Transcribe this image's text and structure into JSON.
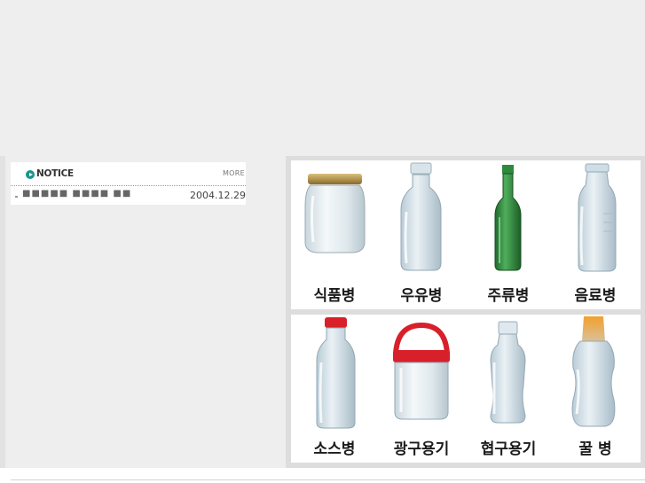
{
  "notice": {
    "title": "NOTICE",
    "more_label": "MORE",
    "items": [
      {
        "title": "■■■■■ ■■■■ ■■",
        "date": "2004.12.29"
      }
    ]
  },
  "catalog": {
    "rows": [
      [
        {
          "label": "식품병",
          "icon": "food-jar-icon"
        },
        {
          "label": "우유병",
          "icon": "milk-bottle-icon"
        },
        {
          "label": "주류병",
          "icon": "liquor-bottle-icon"
        },
        {
          "label": "음료병",
          "icon": "beverage-bottle-icon"
        }
      ],
      [
        {
          "label": "소스병",
          "icon": "sauce-bottle-icon"
        },
        {
          "label": "광구용기",
          "icon": "wide-mouth-container-icon"
        },
        {
          "label": "협구용기",
          "icon": "narrow-mouth-container-icon"
        },
        {
          "label": "꿀 병",
          "icon": "honey-bottle-icon"
        }
      ]
    ]
  },
  "colors": {
    "background": "#eeeeee",
    "accent_teal": "#19958c",
    "cap_red": "#d8202a",
    "glass_green": "#2f8a3c",
    "cap_gold": "#b08a3a"
  }
}
